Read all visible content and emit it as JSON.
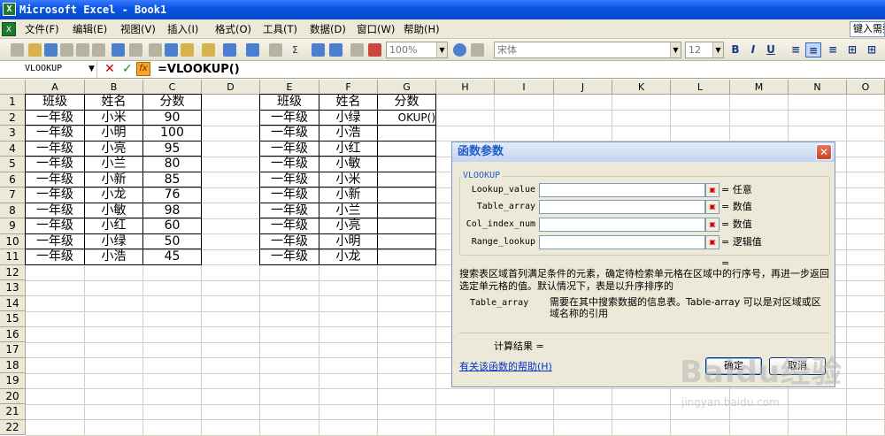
{
  "window": {
    "title": "Microsoft Excel - Book1",
    "app_icon": "excel-icon"
  },
  "menu": [
    {
      "label": "文件(F)"
    },
    {
      "label": "编辑(E)"
    },
    {
      "label": "视图(V)"
    },
    {
      "label": "插入(I)"
    },
    {
      "label": "格式(O)"
    },
    {
      "label": "工具(T)"
    },
    {
      "label": "数据(D)"
    },
    {
      "label": "窗口(W)"
    },
    {
      "label": "帮助(H)"
    }
  ],
  "help_box": {
    "text": "键入需要"
  },
  "toolbar": {
    "zoom": "100%",
    "font": "宋体",
    "font_size": "12",
    "bold": "B",
    "italic": "I",
    "underline": "U"
  },
  "formula_bar": {
    "name_box": "VLOOKUP",
    "cancel": "✕",
    "enter": "✓",
    "fx": "fx",
    "formula": "=VLOOKUP()"
  },
  "columns": [
    "A",
    "B",
    "C",
    "D",
    "E",
    "F",
    "G",
    "H",
    "I",
    "J",
    "K",
    "L",
    "M",
    "N",
    "O"
  ],
  "rows": [
    "1",
    "2",
    "3",
    "4",
    "5",
    "6",
    "7",
    "8",
    "9",
    "10",
    "11",
    "12",
    "13",
    "14",
    "15",
    "16",
    "17",
    "18",
    "19",
    "20",
    "21",
    "22"
  ],
  "table1": {
    "headers": [
      "班级",
      "姓名",
      "分数"
    ],
    "rows": [
      [
        "一年级",
        "小米",
        "90"
      ],
      [
        "一年级",
        "小明",
        "100"
      ],
      [
        "一年级",
        "小亮",
        "95"
      ],
      [
        "一年级",
        "小兰",
        "80"
      ],
      [
        "一年级",
        "小新",
        "85"
      ],
      [
        "一年级",
        "小龙",
        "76"
      ],
      [
        "一年级",
        "小敏",
        "98"
      ],
      [
        "一年级",
        "小红",
        "60"
      ],
      [
        "一年级",
        "小绿",
        "50"
      ],
      [
        "一年级",
        "小浩",
        "45"
      ]
    ]
  },
  "table2": {
    "headers": [
      "班级",
      "姓名",
      "分数"
    ],
    "rows": [
      [
        "一年级",
        "小绿",
        "OKUP()"
      ],
      [
        "一年级",
        "小浩",
        ""
      ],
      [
        "一年级",
        "小红",
        ""
      ],
      [
        "一年级",
        "小敏",
        ""
      ],
      [
        "一年级",
        "小米",
        ""
      ],
      [
        "一年级",
        "小新",
        ""
      ],
      [
        "一年级",
        "小兰",
        ""
      ],
      [
        "一年级",
        "小亮",
        ""
      ],
      [
        "一年级",
        "小明",
        ""
      ],
      [
        "一年级",
        "小龙",
        ""
      ]
    ]
  },
  "dialog": {
    "title": "函数参数",
    "close": "✕",
    "group_label": "VLOOKUP",
    "args": [
      {
        "name": "Lookup_value",
        "type": "= 任意",
        "value": ""
      },
      {
        "name": "Table_array",
        "type": "= 数值",
        "value": ""
      },
      {
        "name": "Col_index_num",
        "type": "= 数值",
        "value": ""
      },
      {
        "name": "Range_lookup",
        "type": "= 逻辑值",
        "value": ""
      }
    ],
    "result_eq": "=",
    "description": "搜索表区域首列满足条件的元素，确定待检索单元格在区域中的行序号，再进一步返回选定单元格的值。默认情况下，表是以升序排序的",
    "arg_desc_name": "Table_array",
    "arg_desc_text": "需要在其中搜索数据的信息表。Table-array 可以是对区域或区域名称的引用",
    "calc_result": "计算结果 =",
    "help_link": "有关该函数的帮助(H)",
    "ok": "确定",
    "cancel": "取消"
  },
  "watermark": {
    "text": "Baidu经验",
    "url": "jingyan.baidu.com"
  }
}
